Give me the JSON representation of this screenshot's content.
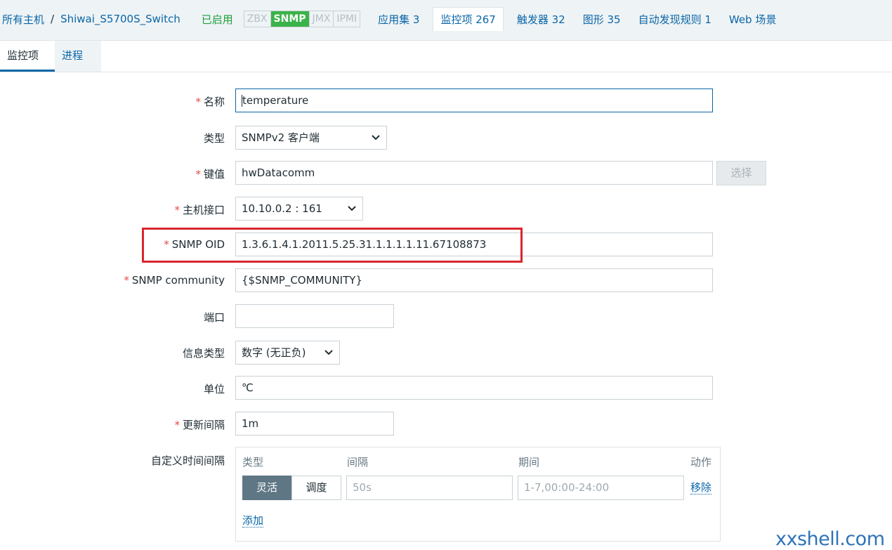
{
  "breadcrumb": {
    "all_hosts": "所有主机",
    "separator": "/",
    "host": "Shiwai_S5700S_Switch"
  },
  "status": "已启用",
  "protocols": [
    {
      "label": "ZBX",
      "active": false
    },
    {
      "label": "SNMP",
      "active": true
    },
    {
      "label": "JMX",
      "active": false
    },
    {
      "label": "IPMI",
      "active": false
    }
  ],
  "nav_tabs": {
    "applications": "应用集 3",
    "items": "监控项 267",
    "triggers": "触发器 32",
    "graphs": "图形 35",
    "discovery": "自动发现规则 1",
    "web": "Web 场景"
  },
  "sub_tabs": {
    "item": "监控项",
    "preprocessing": "进程"
  },
  "form": {
    "name": {
      "label": "名称",
      "value": "temperature"
    },
    "type": {
      "label": "类型",
      "value": "SNMPv2 客户端"
    },
    "key": {
      "label": "键值",
      "value": "hwDatacomm",
      "button": "选择"
    },
    "interface": {
      "label": "主机接口",
      "value": "10.10.0.2 : 161"
    },
    "snmp_oid": {
      "label": "SNMP OID",
      "value": "1.3.6.1.4.1.2011.5.25.31.1.1.1.1.11.67108873"
    },
    "snmp_community": {
      "label": "SNMP community",
      "value": "{$SNMP_COMMUNITY}"
    },
    "port": {
      "label": "端口",
      "value": ""
    },
    "info_type": {
      "label": "信息类型",
      "value": "数字 (无正负)"
    },
    "units": {
      "label": "单位",
      "value": "℃"
    },
    "update_interval": {
      "label": "更新间隔",
      "value": "1m"
    },
    "custom_intervals": {
      "label": "自定义时间间隔",
      "col_type": "类型",
      "col_interval": "间隔",
      "col_period": "期间",
      "col_action": "动作",
      "seg_flexible": "灵活",
      "seg_scheduling": "调度",
      "interval_placeholder": "50s",
      "period_placeholder": "1-7,00:00-24:00",
      "remove": "移除",
      "add": "添加"
    }
  },
  "watermark": "xxshell.com",
  "colors": {
    "link": "#0a66a8",
    "enabled": "#1d9f3b",
    "snmp_active": "#3bb34a",
    "required": "#e04d45",
    "highlight": "#d9262e"
  }
}
